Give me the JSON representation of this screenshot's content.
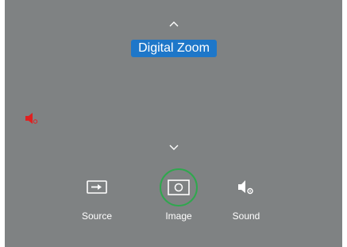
{
  "osd": {
    "title": "Digital Zoom",
    "up_icon": "chevron-up-icon",
    "down_icon": "chevron-down-icon",
    "status_icon": "speaker-muted-icon",
    "accent_color": "#1e77c9",
    "selection_color": "#2fa84e",
    "mute_color": "#e02020"
  },
  "menu": {
    "items": [
      {
        "label": "Source",
        "icon": "input-source-icon",
        "selected": false
      },
      {
        "label": "Image",
        "icon": "image-icon",
        "selected": true
      },
      {
        "label": "Sound",
        "icon": "sound-settings-icon",
        "selected": false
      }
    ]
  }
}
